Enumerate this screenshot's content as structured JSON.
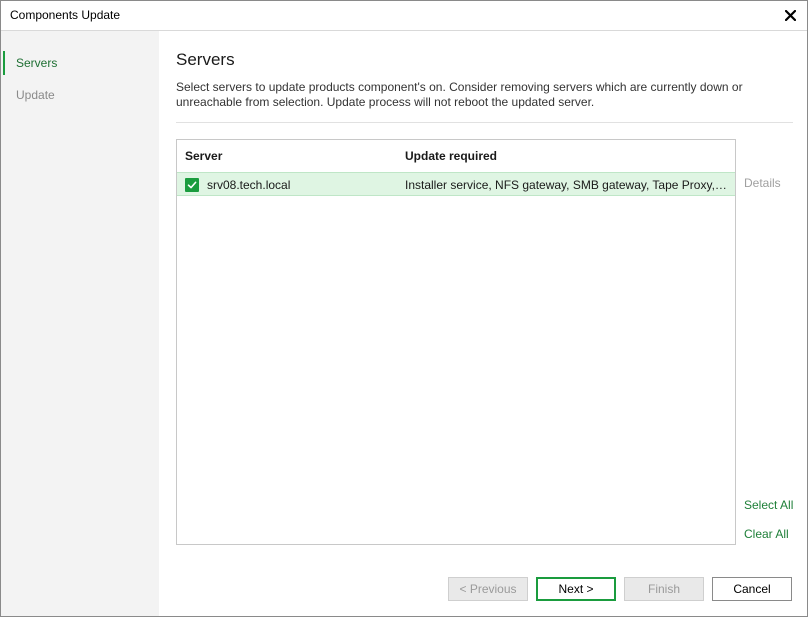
{
  "window": {
    "title": "Components Update"
  },
  "sidebar": {
    "items": [
      {
        "label": "Servers"
      },
      {
        "label": "Update"
      }
    ]
  },
  "main": {
    "title": "Servers",
    "description": "Select servers to update products component's on. Consider removing servers which are currently down or unreachable from selection. Update process will not reboot the updated server.",
    "table": {
      "columns": [
        "Server",
        "Update required"
      ],
      "rows": [
        {
          "server": "srv08.tech.local",
          "update": "Installer service, NFS gateway, SMB gateway, Tape Proxy, Ve...",
          "checked": true
        }
      ]
    },
    "links": {
      "details": "Details",
      "select_all": "Select All",
      "clear_all": "Clear All"
    }
  },
  "footer": {
    "previous": "< Previous",
    "next": "Next >",
    "finish": "Finish",
    "cancel": "Cancel"
  },
  "colors": {
    "accent": "#1a9c3e",
    "selected_row": "#dff5e3",
    "sidebar_bg": "#f3f3f3"
  }
}
